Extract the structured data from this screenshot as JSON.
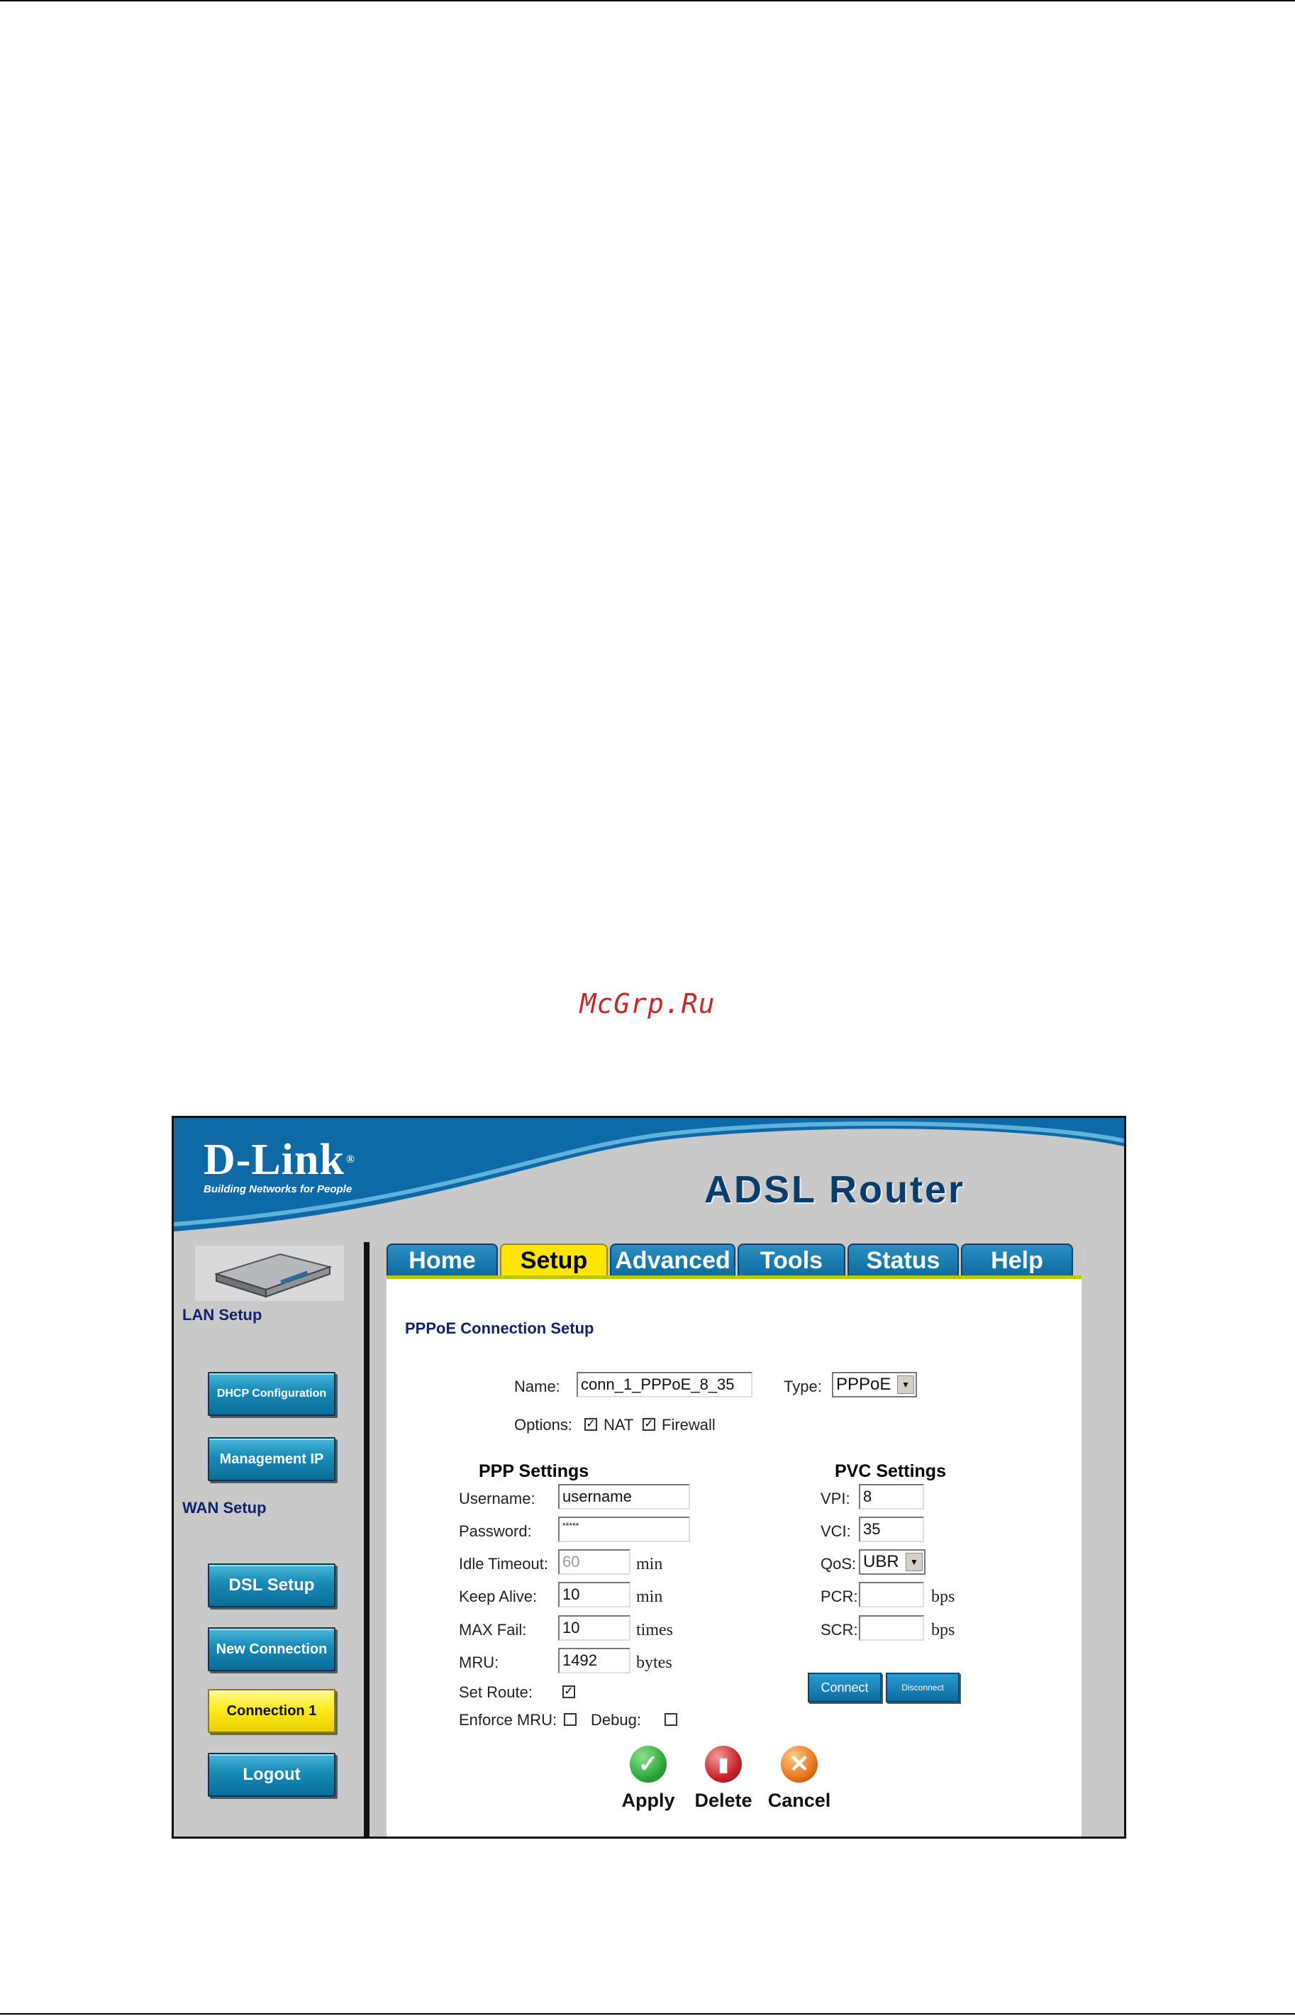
{
  "watermark": "McGrp.Ru",
  "header": {
    "logo_main": "D-Link",
    "logo_reg": "®",
    "logo_tagline": "Building Networks for People",
    "product": "ADSL Router"
  },
  "tabs": [
    {
      "label": "Home",
      "active": false
    },
    {
      "label": "Setup",
      "active": true
    },
    {
      "label": "Advanced",
      "active": false
    },
    {
      "label": "Tools",
      "active": false
    },
    {
      "label": "Status",
      "active": false
    },
    {
      "label": "Help",
      "active": false
    }
  ],
  "sidebar": {
    "lan_label": "LAN Setup",
    "wan_label": "WAN Setup",
    "buttons": {
      "dhcp": "DHCP Configuration",
      "mgmt_ip": "Management IP",
      "dsl_setup": "DSL Setup",
      "new_connection": "New Connection",
      "connection1": "Connection 1",
      "logout": "Logout"
    }
  },
  "form": {
    "title": "PPPoE Connection Setup",
    "name_label": "Name:",
    "name_value": "conn_1_PPPoE_8_35",
    "type_label": "Type:",
    "type_value": "PPPoE",
    "options_label": "Options:",
    "nat_label": "NAT",
    "nat_checked": true,
    "firewall_label": "Firewall",
    "firewall_checked": true,
    "ppp": {
      "heading": "PPP Settings",
      "username_label": "Username:",
      "username_value": "username",
      "password_label": "Password:",
      "password_value": "*****",
      "idle_label": "Idle Timeout:",
      "idle_value": "60",
      "idle_unit": "min",
      "keepalive_label": "Keep Alive:",
      "keepalive_value": "10",
      "keepalive_unit": "min",
      "maxfail_label": "MAX Fail:",
      "maxfail_value": "10",
      "maxfail_unit": "times",
      "mru_label": "MRU:",
      "mru_value": "1492",
      "mru_unit": "bytes",
      "setroute_label": "Set Route:",
      "setroute_checked": true,
      "enforcemru_label": "Enforce MRU:",
      "enforcemru_checked": false,
      "debug_label": "Debug:",
      "debug_checked": false
    },
    "pvc": {
      "heading": "PVC Settings",
      "vpi_label": "VPI:",
      "vpi_value": "8",
      "vci_label": "VCI:",
      "vci_value": "35",
      "qos_label": "QoS:",
      "qos_value": "UBR",
      "pcr_label": "PCR:",
      "pcr_value": "",
      "pcr_unit": "bps",
      "scr_label": "SCR:",
      "scr_value": "",
      "scr_unit": "bps"
    },
    "connect_label": "Connect",
    "disconnect_label": "Disconnect",
    "apply_label": "Apply",
    "delete_label": "Delete",
    "cancel_label": "Cancel"
  },
  "colors": {
    "banner_blue": "#0d6aa6",
    "tab_blue": "#0d6ba0",
    "active_yellow": "#ffe500",
    "apply_green": "#2fa83a",
    "delete_red": "#c8242a",
    "cancel_orange": "#e8741c"
  }
}
